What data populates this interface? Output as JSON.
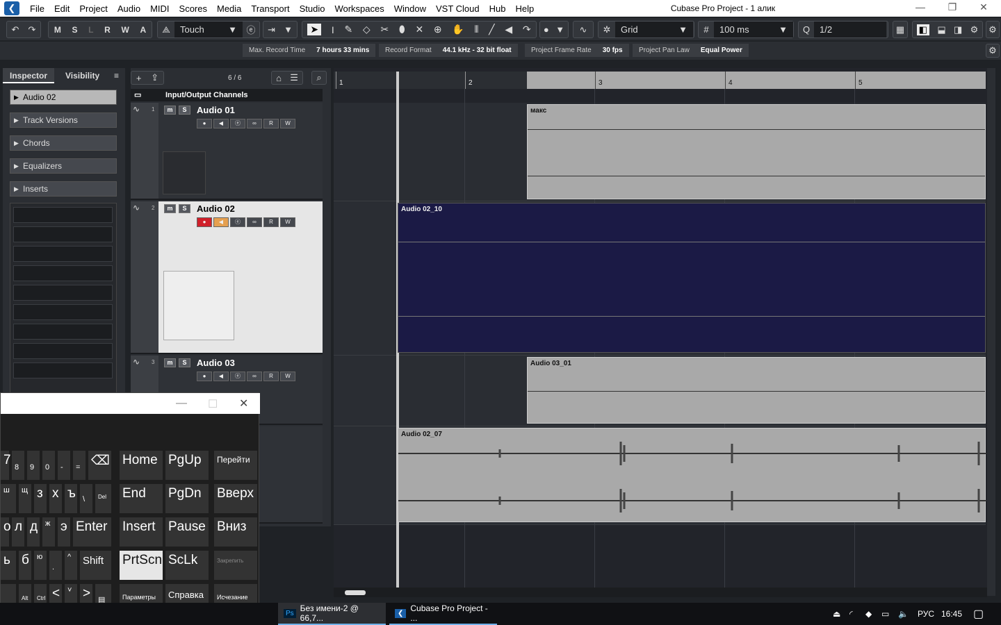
{
  "window": {
    "title": "Cubase Pro Project - 1 алик"
  },
  "menu": [
    "File",
    "Edit",
    "Project",
    "Audio",
    "MIDI",
    "Scores",
    "Media",
    "Transport",
    "Studio",
    "Workspaces",
    "Window",
    "VST Cloud",
    "Hub",
    "Help"
  ],
  "toolbar": {
    "modes": [
      "M",
      "S",
      "L",
      "R",
      "W",
      "A"
    ],
    "automation_mode": "Touch",
    "snap_type": "Grid",
    "grid_value": "100 ms",
    "quantize": "1/2"
  },
  "info": [
    {
      "label": "Max. Record Time",
      "value": "7 hours 33 mins"
    },
    {
      "label": "Record Format",
      "value": "44.1 kHz - 32 bit float"
    },
    {
      "label": "Project Frame Rate",
      "value": "30 fps"
    },
    {
      "label": "Project Pan Law",
      "value": "Equal Power"
    }
  ],
  "inspector": {
    "tabs": [
      "Inspector",
      "Visibility"
    ],
    "track": "Audio 02",
    "sections": [
      "Track Versions",
      "Chords",
      "Equalizers",
      "Inserts"
    ]
  },
  "tracklist": {
    "counter": "6 / 6",
    "folder": "Input/Output Channels",
    "tracks": [
      {
        "num": "1",
        "name": "Audio 01"
      },
      {
        "num": "2",
        "name": "Audio 02"
      },
      {
        "num": "3",
        "name": "Audio 03"
      }
    ]
  },
  "ruler": [
    "1",
    "2",
    "3",
    "4",
    "5"
  ],
  "events": [
    "макс",
    "Audio 02_10",
    "Audio 03_01",
    "Audio 02_07"
  ],
  "keyboard": {
    "row1": [
      "7",
      "8",
      "9",
      "0",
      "-",
      "=",
      "⌫"
    ],
    "row1_top": [
      "*",
      "(",
      ")",
      "_",
      "+"
    ],
    "row2": [
      "ш",
      "щ",
      "з",
      "х",
      "ъ",
      "\\",
      "Del"
    ],
    "row3": [
      "о",
      "л",
      "д",
      "ж",
      "э",
      "Enter"
    ],
    "row4": [
      "ь",
      "б",
      "ю",
      ".",
      "^",
      "Shift"
    ],
    "row5": [
      "Alt",
      "Ctrl",
      "<",
      "˅",
      ">"
    ],
    "nav": [
      "Home",
      "PgUp",
      "Перейти",
      "End",
      "PgDn",
      "Вверх",
      "Insert",
      "Pause",
      "Вниз",
      "PrtScn",
      "ScLk",
      "Закрепить",
      "Параметры",
      "Справка",
      "Исчезание"
    ]
  },
  "taskbar": {
    "apps": [
      "Без имени-2 @ 66,7...",
      "Cubase Pro Project - ..."
    ],
    "lang": "РУС",
    "time": "16:45"
  },
  "colors": {
    "selected_event": "#1b1a45",
    "event": "#a9a9a9",
    "record": "#d0202a"
  }
}
